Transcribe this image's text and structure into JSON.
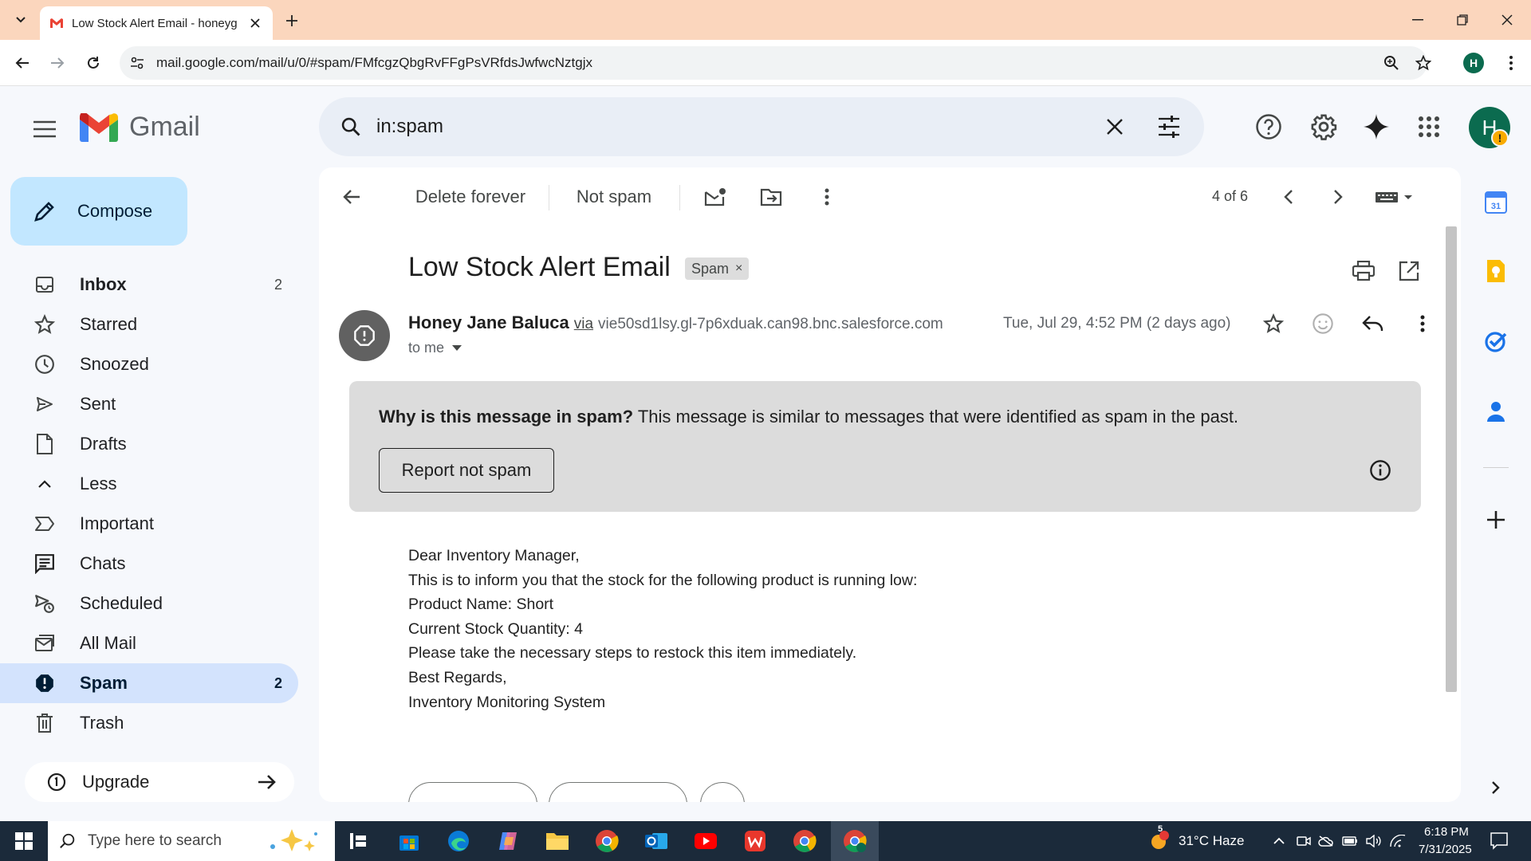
{
  "browser": {
    "tab_title": "Low Stock Alert Email - honeyg",
    "url": "mail.google.com/mail/u/0/#spam/FMfcgzQbgRvFFgPsVRfdsJwfwcNztgjx",
    "profile_initial": "H"
  },
  "gmail": {
    "logo_text": "Gmail",
    "search_value": "in:spam",
    "avatar_initial": "H",
    "avatar_badge": "!"
  },
  "sidebar": {
    "compose_label": "Compose",
    "items": [
      {
        "label": "Inbox",
        "count": "2",
        "icon": "inbox-icon"
      },
      {
        "label": "Starred",
        "count": "",
        "icon": "star-icon"
      },
      {
        "label": "Snoozed",
        "count": "",
        "icon": "clock-icon"
      },
      {
        "label": "Sent",
        "count": "",
        "icon": "send-icon"
      },
      {
        "label": "Drafts",
        "count": "",
        "icon": "draft-icon"
      },
      {
        "label": "Less",
        "count": "",
        "icon": "chevron-up-icon"
      },
      {
        "label": "Important",
        "count": "",
        "icon": "important-icon"
      },
      {
        "label": "Chats",
        "count": "",
        "icon": "chat-icon"
      },
      {
        "label": "Scheduled",
        "count": "",
        "icon": "scheduled-icon"
      },
      {
        "label": "All Mail",
        "count": "",
        "icon": "all-mail-icon"
      },
      {
        "label": "Spam",
        "count": "2",
        "icon": "spam-icon"
      },
      {
        "label": "Trash",
        "count": "",
        "icon": "trash-icon"
      }
    ],
    "upgrade_label": "Upgrade"
  },
  "toolbar": {
    "delete_forever": "Delete forever",
    "not_spam": "Not spam",
    "pager": "4 of 6"
  },
  "email": {
    "subject": "Low Stock Alert Email",
    "label_chip": "Spam",
    "sender_name": "Honey Jane Baluca",
    "via": "via",
    "sender_address": "vie50sd1lsy.gl-7p6xduak.can98.bnc.salesforce.com",
    "to": "to me",
    "date": "Tue, Jul 29, 4:52 PM (2 days ago)",
    "spam_why_bold": "Why is this message in spam?",
    "spam_why_rest": " This message is similar to messages that were identified as spam in the past.",
    "report_not_spam": "Report not spam",
    "body_lines": [
      "Dear Inventory Manager,",
      "This is to inform you that the stock for the following product is running low:",
      "Product Name: Short",
      "Current Stock Quantity: 4",
      "Please take the necessary steps to restock this item immediately.",
      "Best Regards,",
      "Inventory Monitoring System"
    ]
  },
  "taskbar": {
    "search_placeholder": "Type here to search",
    "weather": "31°C  Haze",
    "weather_badge": "5",
    "time": "6:18 PM",
    "date": "7/31/2025"
  },
  "colors": {
    "tabbar_bg": "#fbd6bd",
    "compose_bg": "#c2e7ff",
    "active_nav_bg": "#d3e3fd",
    "spam_box_bg": "#dcdcdc",
    "taskbar_bg": "#1b2a3a"
  }
}
